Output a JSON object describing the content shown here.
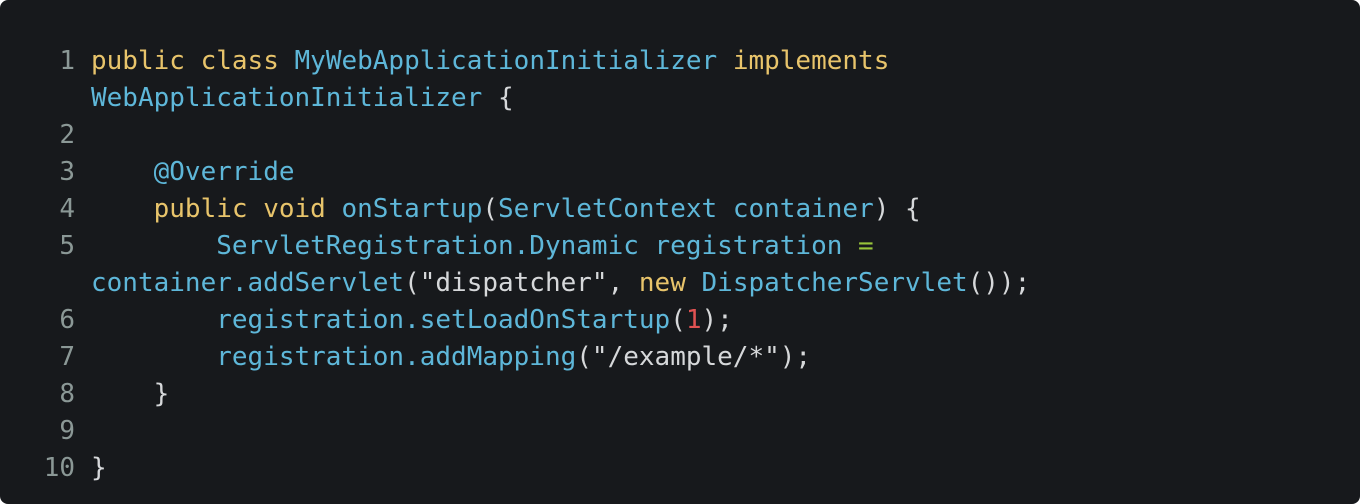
{
  "editor": {
    "background": "#17191c",
    "colors": {
      "keyword": "#e8c46b",
      "type": "#5eb7d9",
      "operator": "#98c43a",
      "number": "#e05252",
      "text": "#d6d8da",
      "gutter": "#8b9896"
    },
    "lines": [
      {
        "num": "1",
        "tokens": [
          {
            "t": "kw",
            "v": "public"
          },
          {
            "t": "plain",
            "v": " "
          },
          {
            "t": "kw",
            "v": "class"
          },
          {
            "t": "plain",
            "v": " "
          },
          {
            "t": "type",
            "v": "MyWebApplicationInitializer"
          },
          {
            "t": "plain",
            "v": " "
          },
          {
            "t": "kw",
            "v": "implements"
          }
        ]
      },
      {
        "num": "",
        "tokens": [
          {
            "t": "type",
            "v": "WebApplicationInitializer"
          },
          {
            "t": "plain",
            "v": " {"
          }
        ]
      },
      {
        "num": "2",
        "tokens": []
      },
      {
        "num": "3",
        "tokens": [
          {
            "t": "plain",
            "v": "    "
          },
          {
            "t": "ann",
            "v": "@Override"
          }
        ]
      },
      {
        "num": "4",
        "tokens": [
          {
            "t": "plain",
            "v": "    "
          },
          {
            "t": "kw",
            "v": "public"
          },
          {
            "t": "plain",
            "v": " "
          },
          {
            "t": "kw",
            "v": "void"
          },
          {
            "t": "plain",
            "v": " "
          },
          {
            "t": "type",
            "v": "onStartup"
          },
          {
            "t": "plain",
            "v": "("
          },
          {
            "t": "type",
            "v": "ServletContext"
          },
          {
            "t": "plain",
            "v": " "
          },
          {
            "t": "type",
            "v": "container"
          },
          {
            "t": "plain",
            "v": ") {"
          }
        ]
      },
      {
        "num": "5",
        "tokens": [
          {
            "t": "plain",
            "v": "        "
          },
          {
            "t": "type",
            "v": "ServletRegistration.Dynamic"
          },
          {
            "t": "plain",
            "v": " "
          },
          {
            "t": "type",
            "v": "registration"
          },
          {
            "t": "plain",
            "v": " "
          },
          {
            "t": "op",
            "v": "="
          }
        ]
      },
      {
        "num": "",
        "tokens": [
          {
            "t": "type",
            "v": "container.addServlet"
          },
          {
            "t": "plain",
            "v": "("
          },
          {
            "t": "str",
            "v": "\"dispatcher\""
          },
          {
            "t": "plain",
            "v": ", "
          },
          {
            "t": "kw",
            "v": "new"
          },
          {
            "t": "plain",
            "v": " "
          },
          {
            "t": "type",
            "v": "DispatcherServlet"
          },
          {
            "t": "plain",
            "v": "());"
          }
        ]
      },
      {
        "num": "6",
        "tokens": [
          {
            "t": "plain",
            "v": "        "
          },
          {
            "t": "type",
            "v": "registration.setLoadOnStartup"
          },
          {
            "t": "plain",
            "v": "("
          },
          {
            "t": "num",
            "v": "1"
          },
          {
            "t": "plain",
            "v": ");"
          }
        ]
      },
      {
        "num": "7",
        "tokens": [
          {
            "t": "plain",
            "v": "        "
          },
          {
            "t": "type",
            "v": "registration.addMapping"
          },
          {
            "t": "plain",
            "v": "("
          },
          {
            "t": "str",
            "v": "\"/example/*\""
          },
          {
            "t": "plain",
            "v": ");"
          }
        ]
      },
      {
        "num": "8",
        "tokens": [
          {
            "t": "plain",
            "v": "    }"
          }
        ]
      },
      {
        "num": "9",
        "tokens": []
      },
      {
        "num": "10",
        "tokens": [
          {
            "t": "plain",
            "v": "}"
          }
        ]
      }
    ]
  }
}
